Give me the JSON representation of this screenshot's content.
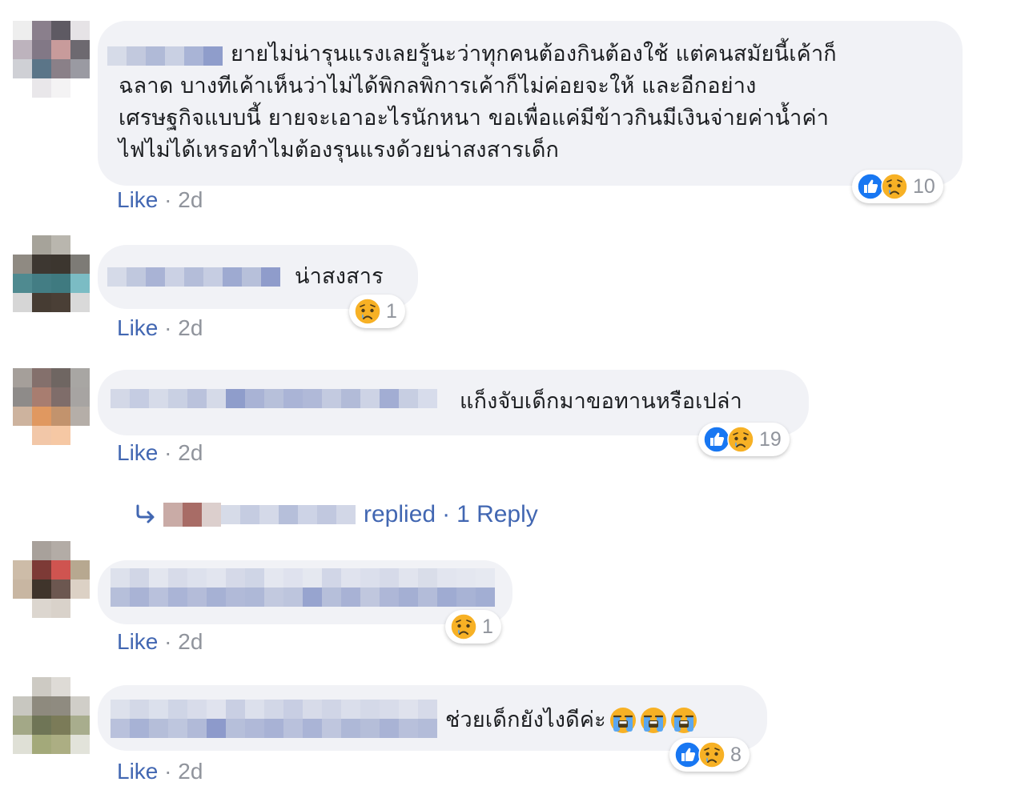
{
  "colors": {
    "link": "#4267b2",
    "meta": "#90949c",
    "bubble": "#f1f2f6",
    "like_blue": "#1877f2",
    "sad_yellow": "#f7b125"
  },
  "comments": [
    {
      "text": "ยายไม่น่ารุนแรงเลยรู้นะว่าทุกคนต้องกินต้องใช้ แต่คนสมัยนี้เค้าก็\nฉลาด บางทีเค้าเห็นว่าไม่ได้พิกลพิการเค้าก็ไม่ค่อยจะให้ และอีกอย่าง\nเศรษฐกิจแบบนี้ ยายจะเอาอะไรนักหนา ขอเพื่อแค่มีข้าวกินมีเงินจ่ายค่าน้ำค่า\nไฟไม่ได้เหรอทำไมต้องรุนแรงด้วยน่าสงสารเด็ก",
      "like_label": "Like",
      "separator": "·",
      "age": "2d",
      "reactions": [
        "like-icon",
        "sad-icon"
      ],
      "reaction_count": "10"
    },
    {
      "text": "น่าสงสาร",
      "like_label": "Like",
      "separator": "·",
      "age": "2d",
      "reactions": [
        "sad-icon"
      ],
      "reaction_count": "1"
    },
    {
      "text": "แก็งจับเด็กมาขอทานหรือเปล่า",
      "like_label": "Like",
      "separator": "·",
      "age": "2d",
      "reactions": [
        "like-icon",
        "sad-icon"
      ],
      "reaction_count": "19",
      "reply": {
        "text": "replied",
        "separator": "·",
        "count_label": "1 Reply"
      }
    },
    {
      "text": "",
      "like_label": "Like",
      "separator": "·",
      "age": "2d",
      "reactions": [
        "sad-icon"
      ],
      "reaction_count": "1"
    },
    {
      "text": "ช่วยเด็กยังไงดีค่ะ",
      "like_label": "Like",
      "separator": "·",
      "age": "2d",
      "inline_emojis": [
        "crying-emoji",
        "crying-emoji",
        "crying-emoji"
      ],
      "reactions": [
        "like-icon",
        "sad-icon"
      ],
      "reaction_count": "8"
    }
  ]
}
